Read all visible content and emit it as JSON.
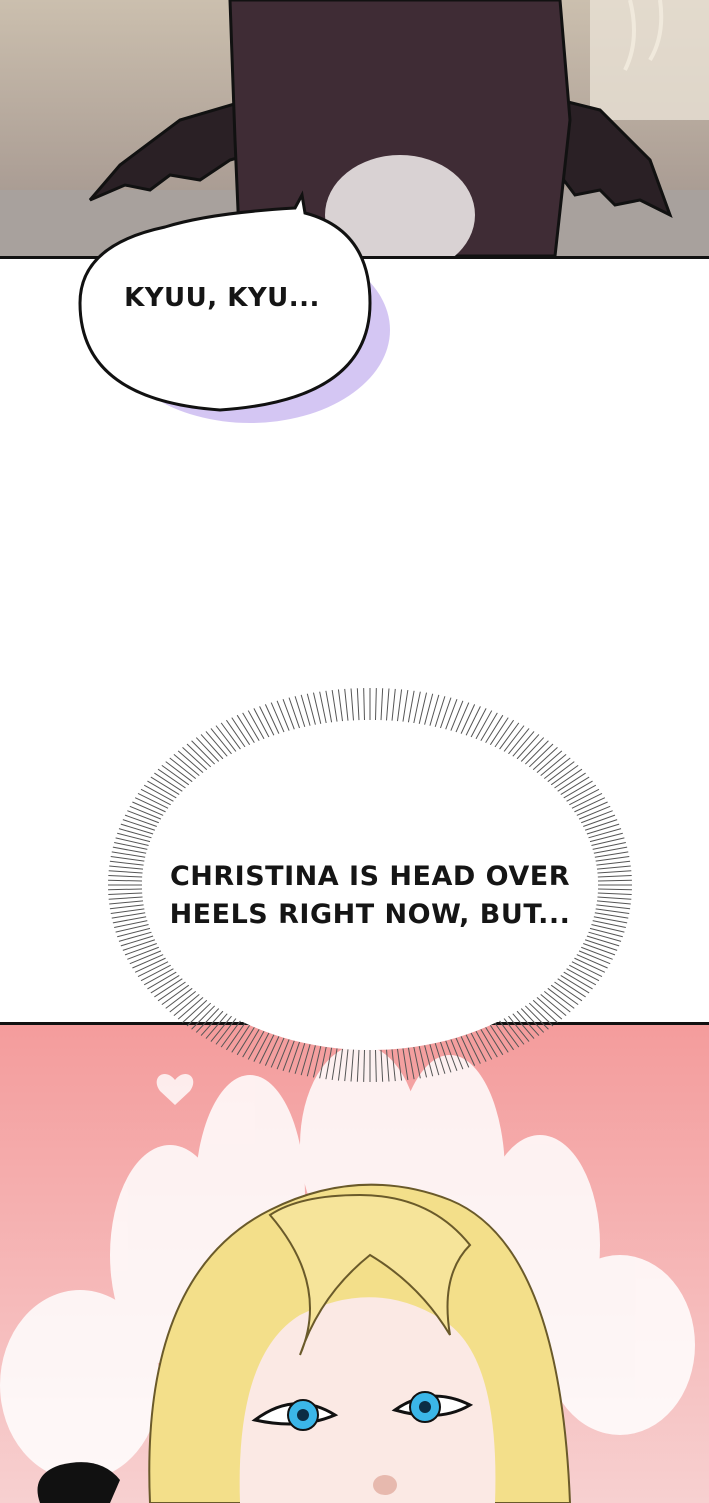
{
  "speech_bubble": {
    "text": "KYUU, KYU..."
  },
  "thought_bubble": {
    "text": "CHRISTINA IS HEAD OVER HEELS RIGHT NOW, BUT..."
  },
  "colors": {
    "panel_top_bg": "#b9aba2",
    "creature_body": "#3f2c35",
    "creature_belly": "#d9d2d3",
    "bubble_shadow": "#c9b8f0",
    "panel_bottom_bg": "#f2a8a8",
    "hair": "#f3df8a",
    "eyes": "#3bb6e8"
  }
}
